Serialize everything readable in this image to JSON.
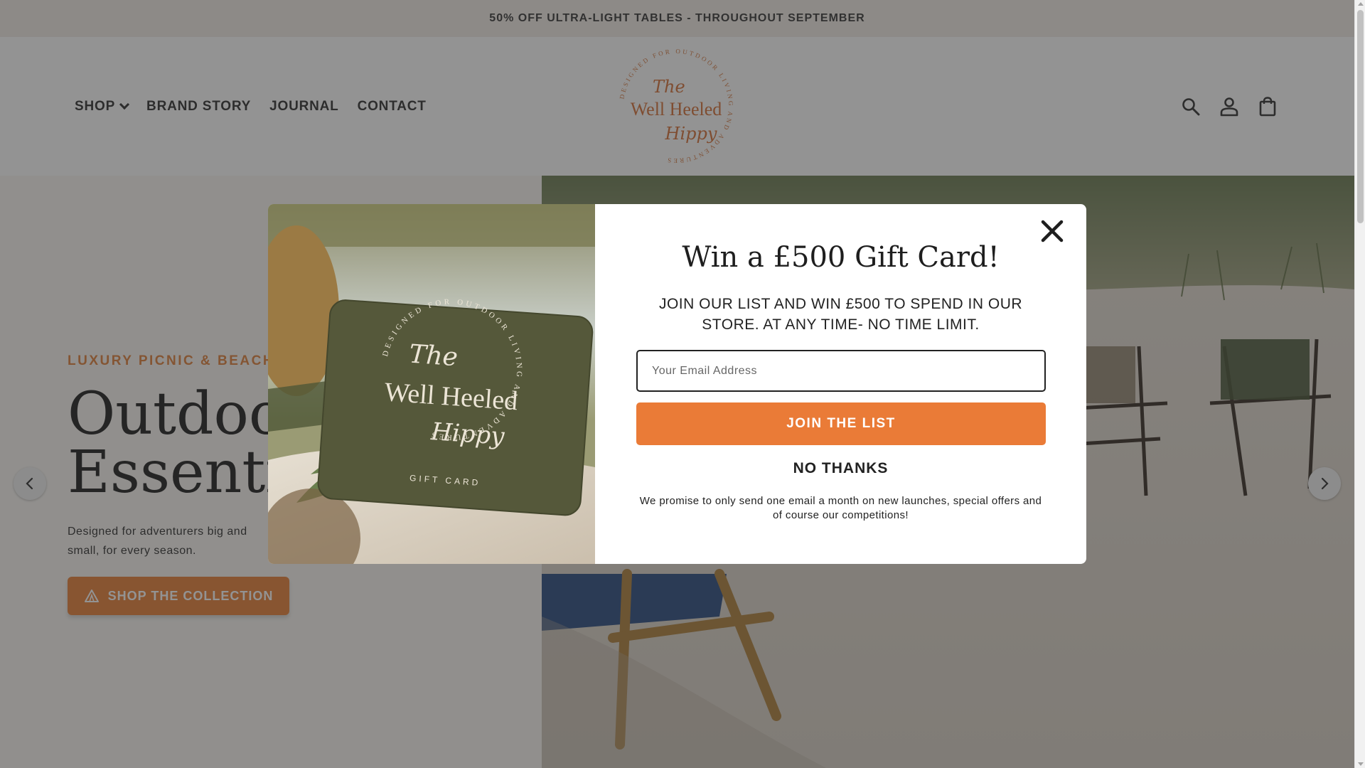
{
  "announcement": "50% OFF ULTRA-LIGHT TABLES - THROUGHOUT SEPTEMBER",
  "nav": {
    "shop": "SHOP",
    "brand_story": "BRAND STORY",
    "journal": "JOURNAL",
    "contact": "CONTACT"
  },
  "logo": {
    "line1": "The",
    "line2": "Well Heeled",
    "line3": "Hippy",
    "ring_text": "DESIGNED FOR OUTDOOR LIVING AND ADVENTURES"
  },
  "icons": [
    "search-icon",
    "account-icon",
    "cart-icon",
    "close-icon",
    "arrow-left-icon",
    "arrow-right-icon",
    "tent-icon"
  ],
  "hero": {
    "eyebrow": "LUXURY PICNIC & BEACH",
    "title_line1": "Outdoor",
    "title_line2": "Essentials",
    "description": "Designed for adventurers big and small, for every season.",
    "button_label": "SHOP THE COLLECTION"
  },
  "modal": {
    "title": "Win a £500 Gift Card!",
    "subtitle": "JOIN OUR LIST AND WIN £500 TO SPEND IN OUR STORE. AT ANY TIME- NO TIME LIMIT.",
    "email_placeholder": "Your Email Address",
    "email_value": "",
    "join_label": "JOIN THE LIST",
    "no_thanks_label": "NO THANKS",
    "fine_print": "We promise to only send one email a month on new launches, special offers and of course our competitions!",
    "gift_card_label": "GIFT CARD"
  },
  "colors": {
    "accent": "#EA7B37",
    "announcement_bg": "#F3ECE7",
    "gift_card": "#55583A"
  }
}
